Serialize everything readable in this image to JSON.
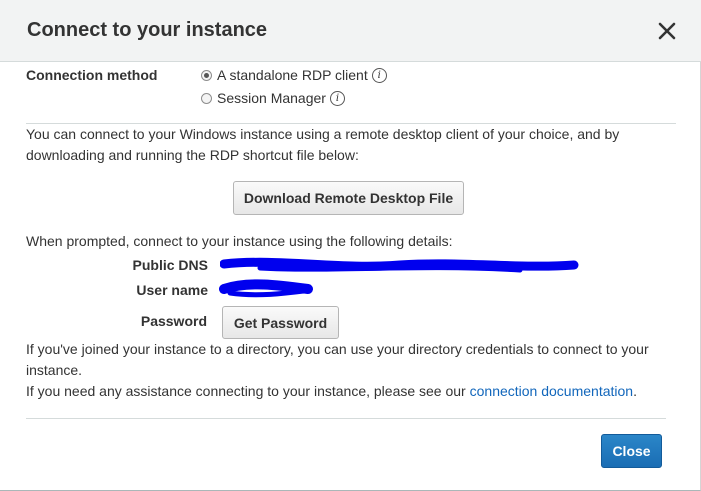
{
  "dialog": {
    "title": "Connect to your instance",
    "close_icon": "close-icon"
  },
  "connection_method": {
    "label": "Connection method",
    "options": [
      {
        "label": "A standalone RDP client",
        "selected": true,
        "icon": "info-icon"
      },
      {
        "label": "Session Manager",
        "selected": false,
        "icon": "info-icon"
      }
    ]
  },
  "intro": {
    "text": "You can connect to your Windows instance using a remote desktop client of your choice, and by downloading and running the RDP shortcut file below:"
  },
  "download_button": {
    "label": "Download Remote Desktop File"
  },
  "details": {
    "prompt": "When prompted, connect to your instance using the following details:",
    "public_dns_label": "Public DNS",
    "user_name_label": "User name",
    "password_label": "Password",
    "get_password_label": "Get Password"
  },
  "directory_note": "If you've joined your instance to a directory, you can use your directory credentials to connect to your instance.",
  "assistance": {
    "text": "If you need any assistance connecting to your instance, please see our",
    "link_label": "connection documentation",
    "suffix": "."
  },
  "footer": {
    "close_label": "Close"
  },
  "colors": {
    "header_bg": "#f2f3f3",
    "primary": "#1a6db4",
    "link": "#1166bb",
    "redaction": "#0000ee"
  }
}
